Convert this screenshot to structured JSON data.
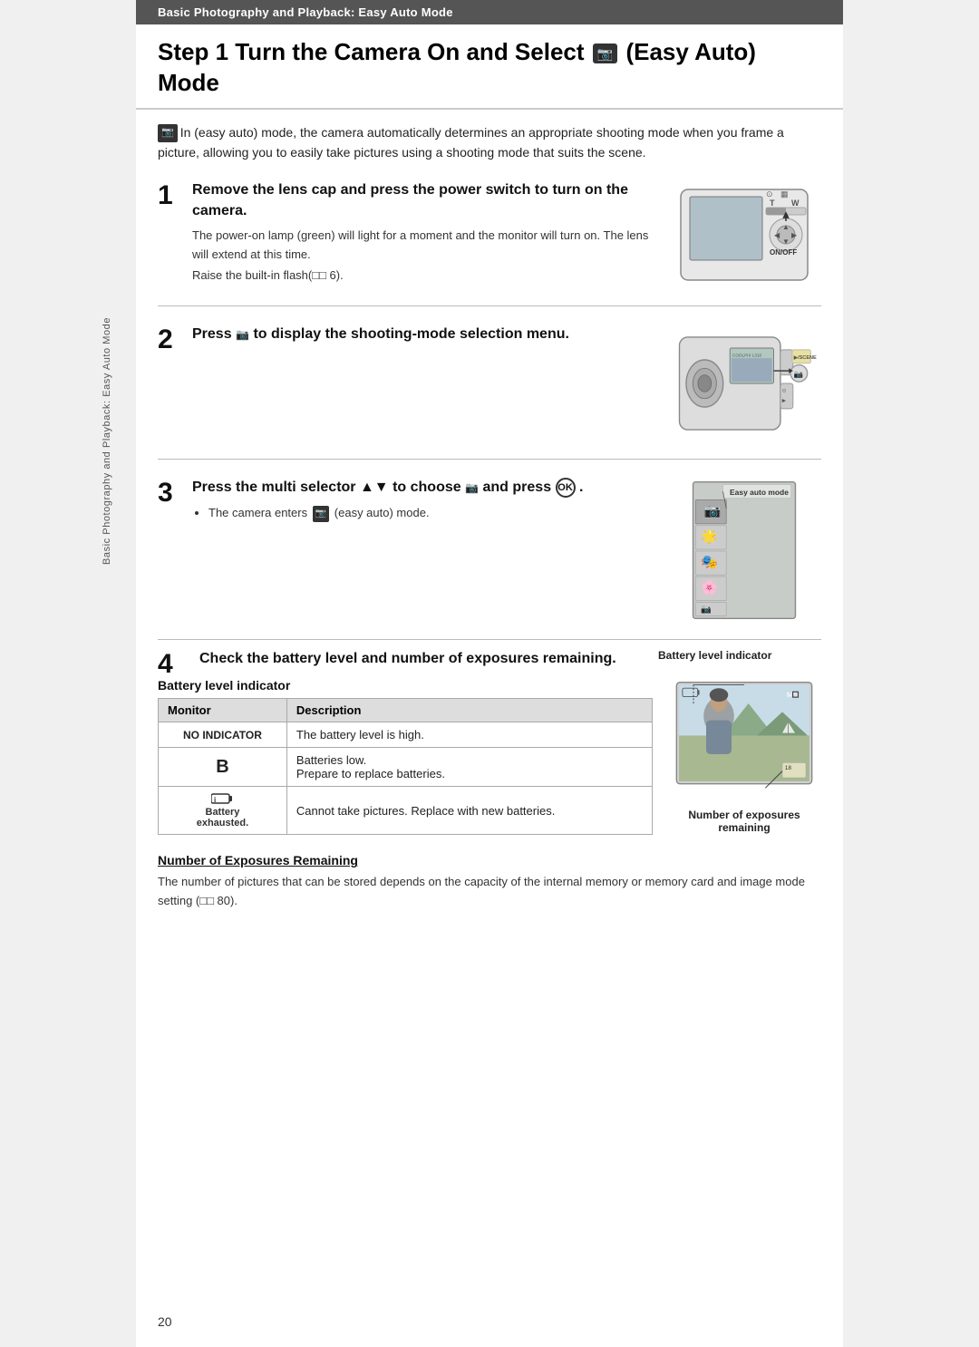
{
  "page": {
    "number": "20",
    "sidebar_text": "Basic Photography and Playback: Easy Auto Mode"
  },
  "top_bar": {
    "label": "Basic Photography and Playback: Easy Auto Mode"
  },
  "main_title": {
    "prefix": "Step 1 Turn the Camera On and Select",
    "icon_label": "🎥",
    "suffix": "(Easy Auto) Mode"
  },
  "intro": {
    "text": "In   (easy auto) mode, the camera automatically determines an appropriate shooting mode when you frame a picture, allowing you to easily take pictures using a shooting mode that suits the scene."
  },
  "step1": {
    "number": "1",
    "title": "Remove the lens cap and press the power switch to turn on the camera.",
    "desc1": "The power-on lamp (green) will light for a moment and the monitor will turn on. The lens will extend at this time.",
    "desc2": "Raise the built-in flash(□□ 6)."
  },
  "step2": {
    "number": "2",
    "title_prefix": "Press",
    "title_icon": "🎥",
    "title_suffix": "to display the shooting-mode selection menu."
  },
  "step3": {
    "number": "3",
    "title_prefix": "Press the multi selector ▲▼ to choose",
    "title_icon": "🎥",
    "title_suffix": "and press",
    "ok_label": "OK",
    "bullet": "The camera enters   (easy auto) mode.",
    "menu_label": "Easy auto mode"
  },
  "step4": {
    "number": "4",
    "title": "Check the battery level and number of exposures remaining.",
    "battery_subtitle": "Battery level indicator",
    "battery_level_label": "Battery level indicator",
    "table": {
      "headers": [
        "Monitor",
        "Description"
      ],
      "rows": [
        {
          "monitor": "NO INDICATOR",
          "description": "The battery level is high.",
          "type": "no_indicator"
        },
        {
          "monitor": "B",
          "description": "Batteries low.\nPrepare to replace batteries.",
          "type": "b"
        },
        {
          "monitor": "battery_icon",
          "monitor_label": "Battery exhausted.",
          "description": "Cannot take pictures. Replace with new batteries.",
          "type": "exhausted"
        }
      ]
    },
    "exposures_remaining_label": "Number of exposures\nremaining"
  },
  "exposures_section": {
    "title": "Number of Exposures Remaining",
    "desc": "The number of pictures that can be stored depends on the capacity of the internal memory or memory card and image mode setting (□□ 80)."
  }
}
